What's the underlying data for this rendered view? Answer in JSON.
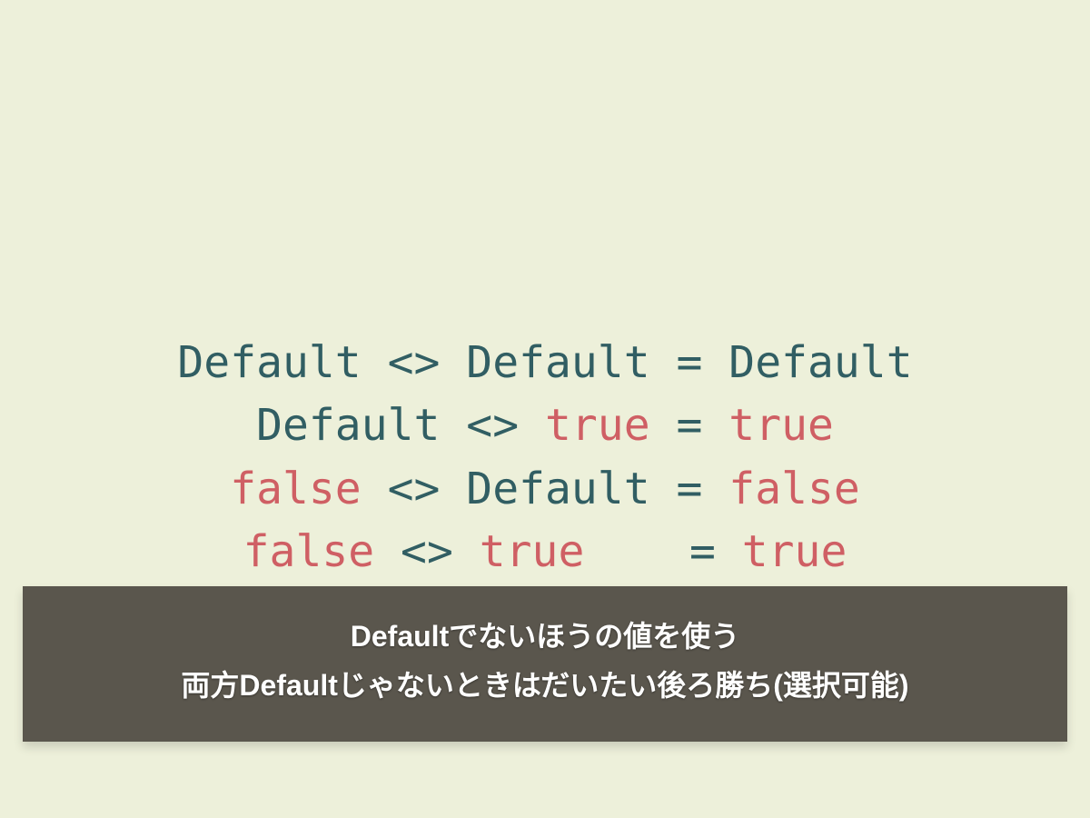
{
  "code": {
    "line1": {
      "a": "Default",
      "op": " <> ",
      "b": "Default",
      "eq": " = ",
      "r": "Default"
    },
    "line2": {
      "a": "Default",
      "op": " <> ",
      "b": "true",
      "eq": " = ",
      "r": "true"
    },
    "line3": {
      "a": "false",
      "op": " <> ",
      "b": "Default",
      "eq": " = ",
      "r": "false"
    },
    "line4": {
      "a": "false",
      "op": " <> ",
      "b": "true",
      "pad": "   ",
      "eq": " = ",
      "r": "true"
    }
  },
  "caption": {
    "line1": "Defaultでないほうの値を使う",
    "line2": "両方Defaultじゃないときはだいたい後ろ勝ち(選択可能)"
  }
}
